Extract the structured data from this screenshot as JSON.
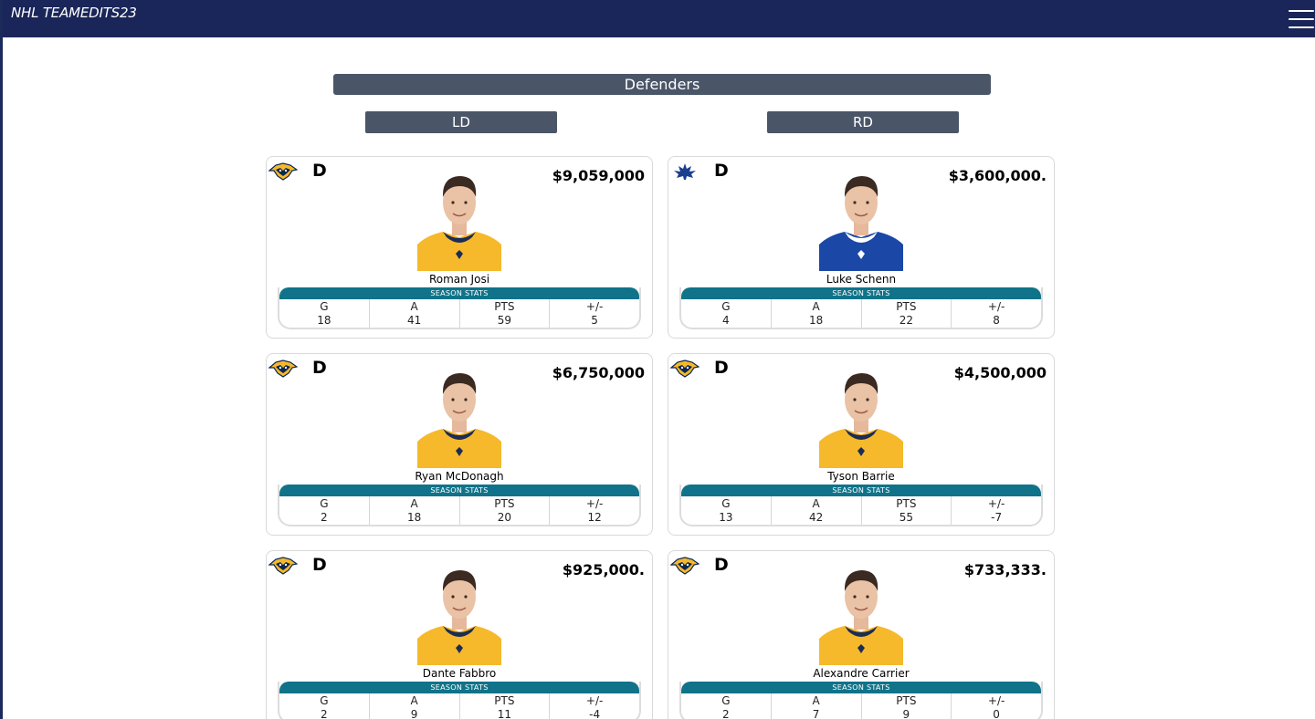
{
  "app": {
    "title": "NHL TEAMEDITS23"
  },
  "section": {
    "title": "Defenders"
  },
  "columns": {
    "left": "LD",
    "right": "RD"
  },
  "stats_header": "SEASON STATS",
  "stat_labels": [
    "G",
    "A",
    "PTS",
    "+/-"
  ],
  "colors": {
    "navbar": "#1a2659",
    "header": "#4a5568",
    "stats_bar": "#107389",
    "jersey_gold": "#f5b92b",
    "jersey_blue": "#1b47a6"
  },
  "players": [
    {
      "position": "D",
      "salary": "$9,059,000",
      "name": "Roman Josi",
      "team_icon": "predators-logo",
      "jersey": "gold",
      "stats": [
        "18",
        "41",
        "59",
        "5"
      ]
    },
    {
      "position": "D",
      "salary": "$3,600,000.",
      "name": "Luke Schenn",
      "team_icon": "maple-leafs-logo",
      "jersey": "blue",
      "stats": [
        "4",
        "18",
        "22",
        "8"
      ]
    },
    {
      "position": "D",
      "salary": "$6,750,000",
      "name": "Ryan McDonagh",
      "team_icon": "predators-logo",
      "jersey": "gold",
      "stats": [
        "2",
        "18",
        "20",
        "12"
      ]
    },
    {
      "position": "D",
      "salary": "$4,500,000",
      "name": "Tyson Barrie",
      "team_icon": "predators-logo",
      "jersey": "gold",
      "stats": [
        "13",
        "42",
        "55",
        "-7"
      ]
    },
    {
      "position": "D",
      "salary": "$925,000.",
      "name": "Dante Fabbro",
      "team_icon": "predators-logo",
      "jersey": "gold",
      "stats": [
        "2",
        "9",
        "11",
        "-4"
      ]
    },
    {
      "position": "D",
      "salary": "$733,333.",
      "name": "Alexandre Carrier",
      "team_icon": "predators-logo",
      "jersey": "gold",
      "stats": [
        "2",
        "7",
        "9",
        "0"
      ]
    }
  ]
}
